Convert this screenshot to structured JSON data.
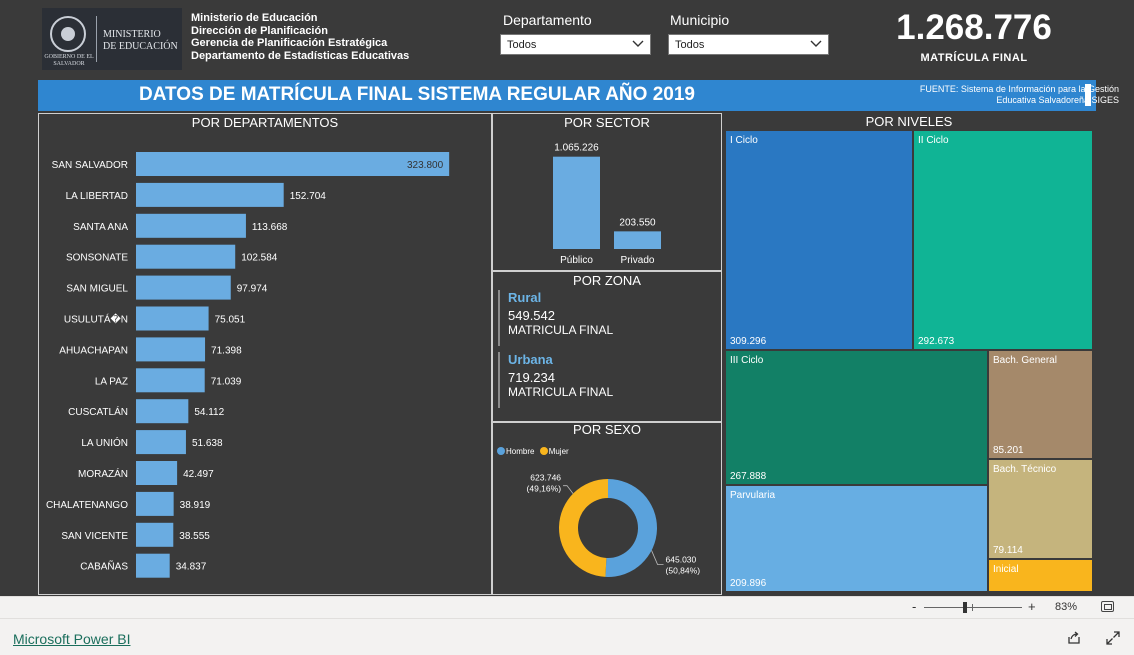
{
  "header": {
    "logo": {
      "emblem_caption": "GOBIERNO DE EL SALVADOR",
      "ministry_line1": "MINISTERIO",
      "ministry_line2": "DE EDUCACIÓN"
    },
    "org_lines": [
      "Ministerio de Educación",
      "Dirección de Planificación",
      "Gerencia de Planificación Estratégica",
      "Departamento de Estadísticas Educativas"
    ],
    "filters": [
      {
        "label": "Departamento",
        "value": "Todos"
      },
      {
        "label": "Municipio",
        "value": "Todos"
      }
    ],
    "kpi": {
      "value": "1.268.776",
      "label": "MATRÍCULA FINAL"
    }
  },
  "title_bar": {
    "title": "DATOS DE MATRÍCULA FINAL SISTEMA REGULAR AÑO 2019",
    "source": "FUENTE: Sistema de Información para la Gestión Educativa Salvadoreña SIGES"
  },
  "zona": {
    "title": "POR ZONA",
    "items": [
      {
        "name": "Rural",
        "value": "549.542",
        "unit": "MATRICULA FINAL"
      },
      {
        "name": "Urbana",
        "value": "719.234",
        "unit": "MATRICULA FINAL"
      }
    ]
  },
  "colors": {
    "bar": "#6aace1",
    "hombre": "#5aa2dc",
    "mujer": "#f9b51d",
    "title_bar": "#2f86d0",
    "background": "#3a3a3a"
  },
  "chart_data": [
    {
      "type": "bar",
      "orientation": "horizontal",
      "title": "POR DEPARTAMENTOS",
      "categories": [
        "SAN SALVADOR",
        "LA LIBERTAD",
        "SANTA ANA",
        "SONSONATE",
        "SAN MIGUEL",
        "USULUTÁ�N",
        "AHUACHAPAN",
        "LA PAZ",
        "CUSCATLÁN",
        "LA UNIÓN",
        "MORAZÁN",
        "CHALATENANGO",
        "SAN VICENTE",
        "CABAÑAS"
      ],
      "values": [
        323800,
        152704,
        113668,
        102584,
        97974,
        75051,
        71398,
        71039,
        54112,
        51638,
        42497,
        38919,
        38555,
        34837
      ],
      "data_labels": [
        "323.800",
        "152.704",
        "113.668",
        "102.584",
        "97.974",
        "75.051",
        "71.398",
        "71.039",
        "54.112",
        "51.638",
        "42.497",
        "38.919",
        "38.555",
        "34.837"
      ],
      "xlim": [
        0,
        335000
      ],
      "grid": false
    },
    {
      "type": "bar",
      "title": "POR SECTOR",
      "categories": [
        "Público",
        "Privado"
      ],
      "values": [
        1065226,
        203550
      ],
      "data_labels": [
        "1.065.226",
        "203.550"
      ],
      "ylim": [
        0,
        1200000
      ],
      "grid": false
    },
    {
      "type": "pie",
      "style": "donut",
      "title": "POR SEXO",
      "legend_position": "top-left",
      "categories": [
        "Hombre",
        "Mujer"
      ],
      "values": [
        645030,
        623746
      ],
      "data_labels": [
        [
          "645.030",
          "(50,84%)"
        ],
        [
          "623.746",
          "(49,16%)"
        ]
      ]
    },
    {
      "type": "treemap",
      "title": "POR NIVELES",
      "tiles": [
        {
          "label": "I Ciclo",
          "value": 309296,
          "value_label": "309.296",
          "color": "#2a78c2"
        },
        {
          "label": "II Ciclo",
          "value": 292673,
          "value_label": "292.673",
          "color": "#10b495"
        },
        {
          "label": "III Ciclo",
          "value": 267888,
          "value_label": "267.888",
          "color": "#128066"
        },
        {
          "label": "Parvularia",
          "value": 209896,
          "value_label": "209.896",
          "color": "#67aee3"
        },
        {
          "label": "Bach. General",
          "value": 85201,
          "value_label": "85.201",
          "color": "#a5896a"
        },
        {
          "label": "Bach. Técnico",
          "value": 79114,
          "value_label": "79.114",
          "color": "#c5b47d"
        },
        {
          "label": "Inicial",
          "value": 0,
          "value_label": "",
          "color": "#f9b51d"
        }
      ]
    }
  ],
  "footer": {
    "brand_link": "Microsoft Power BI",
    "zoom_minus": "-",
    "zoom_plus": "+",
    "zoom_percent": "83%"
  }
}
